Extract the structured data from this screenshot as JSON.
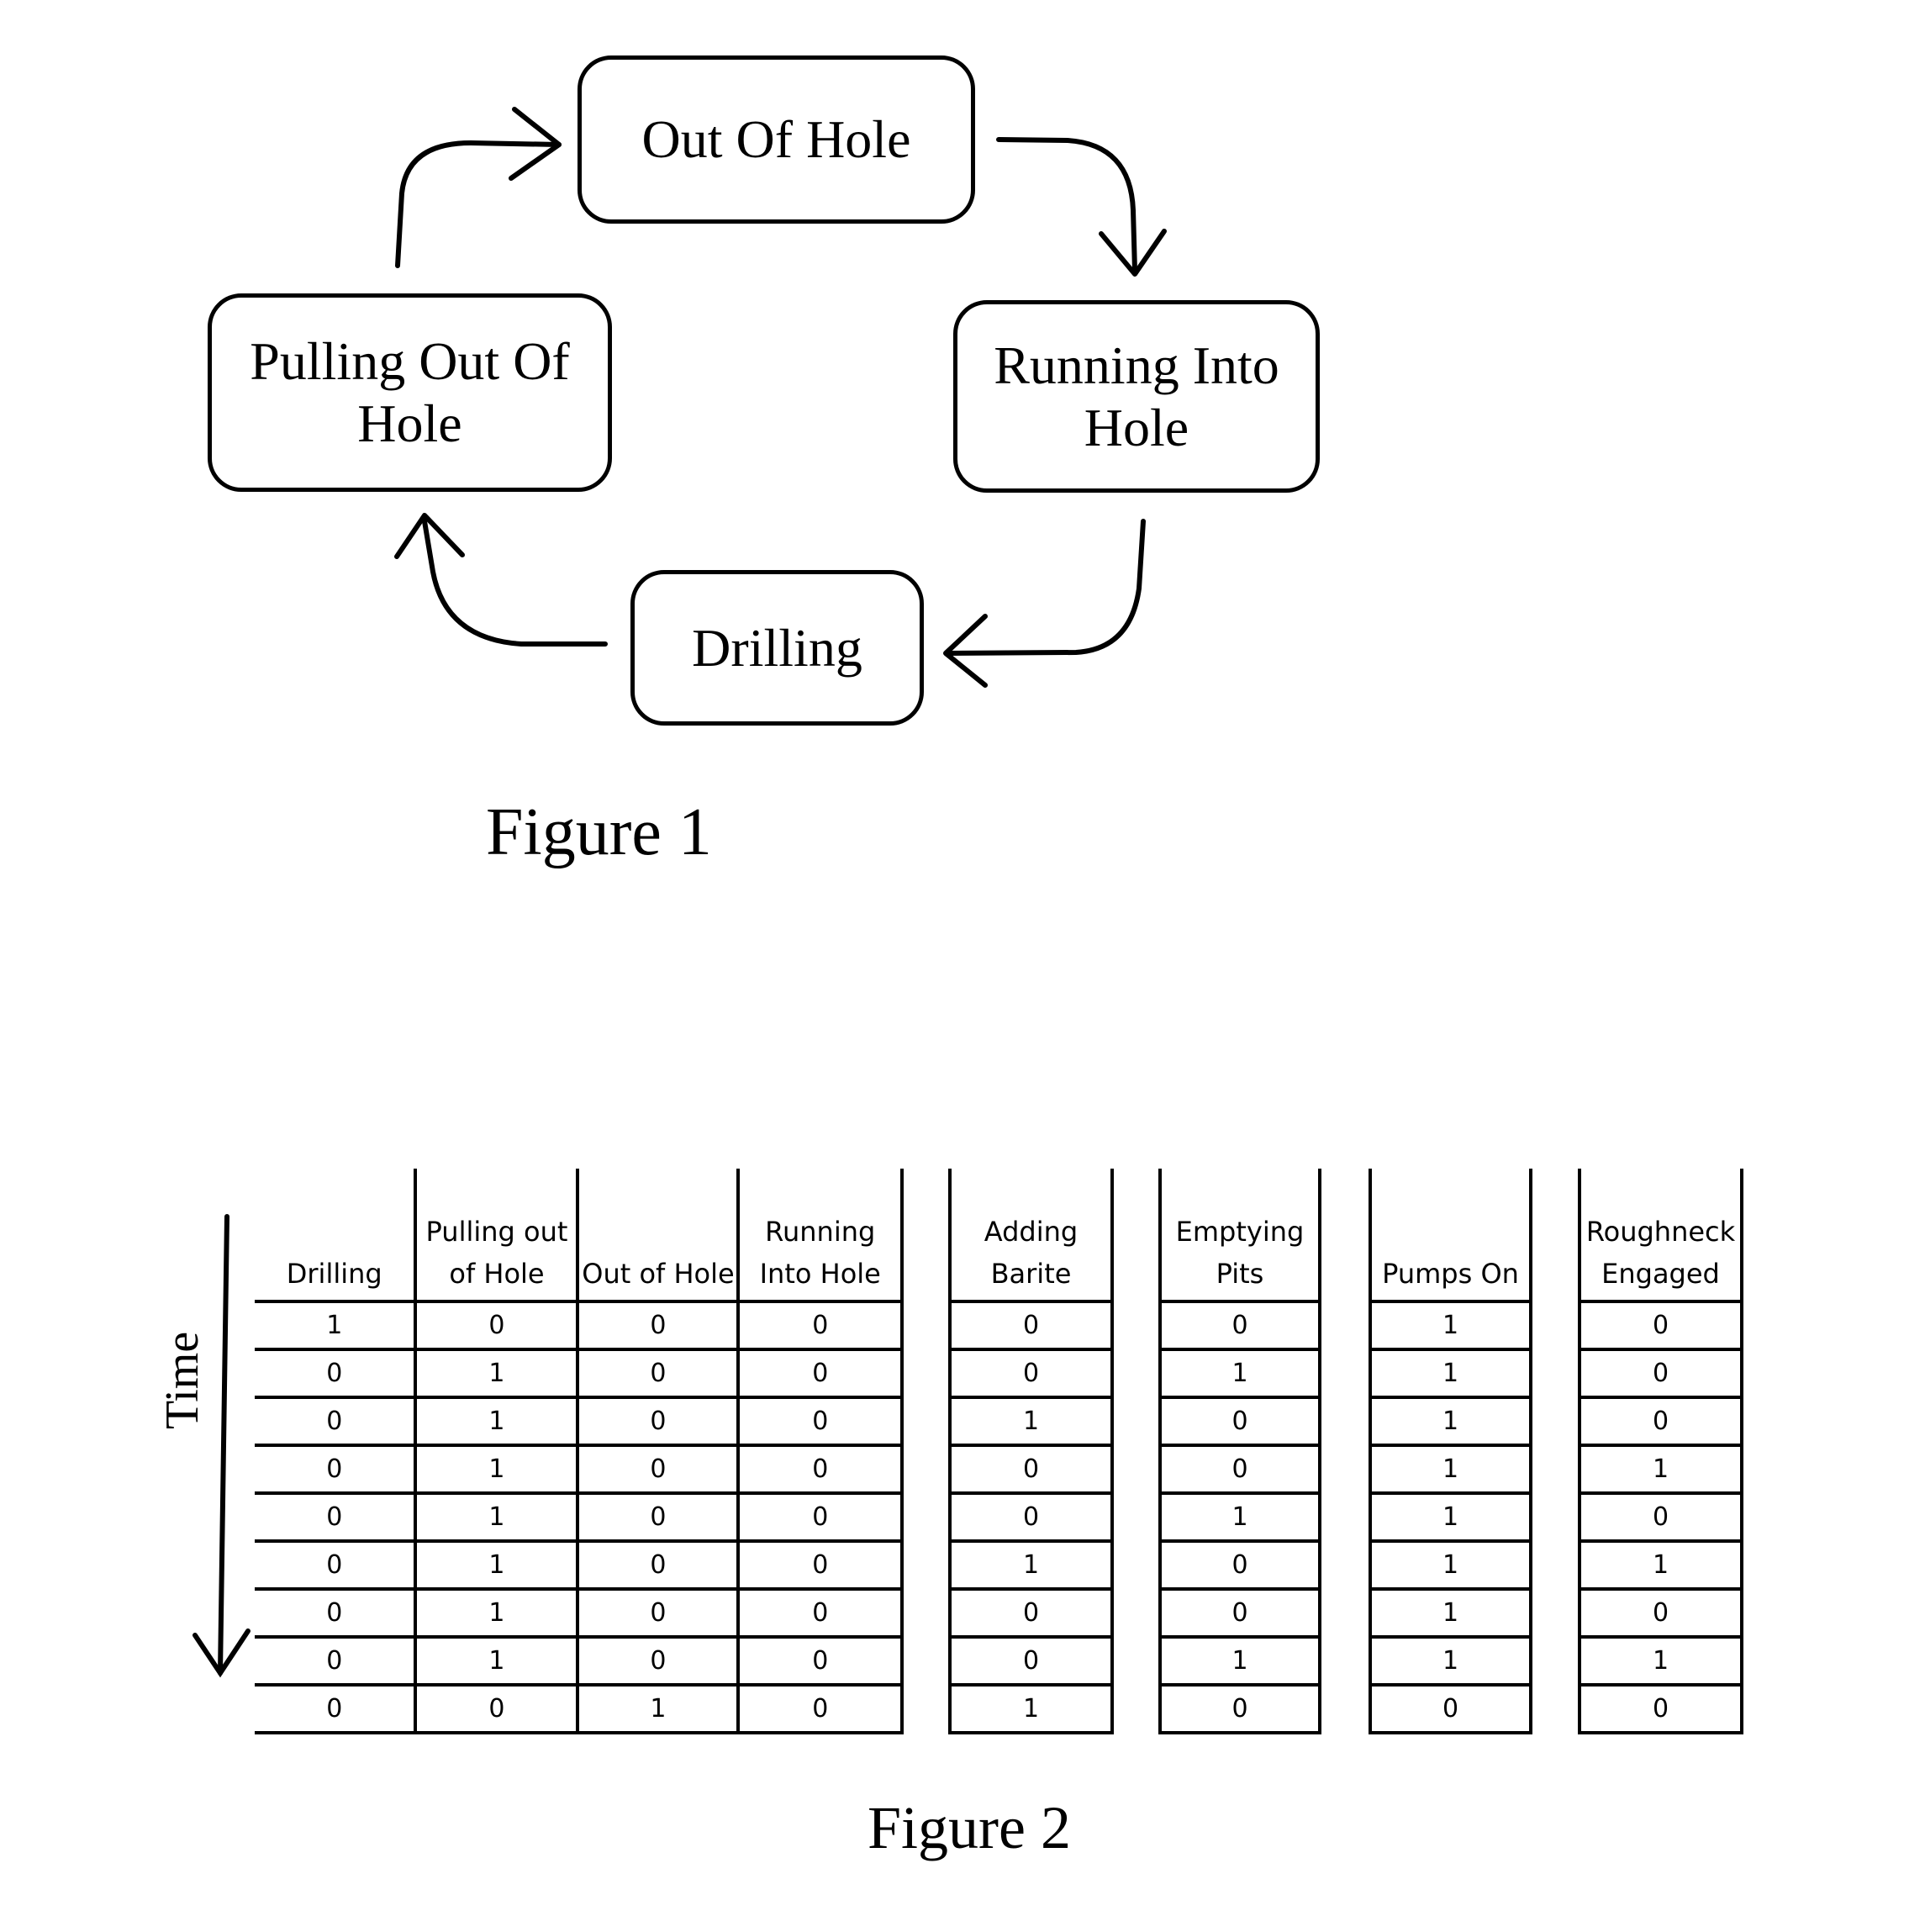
{
  "figure1": {
    "caption": "Figure 1",
    "states": [
      {
        "id": "out-of-hole",
        "label": "Out Of Hole"
      },
      {
        "id": "running-into-hole",
        "label": "Running Into Hole"
      },
      {
        "id": "drilling",
        "label": "Drilling"
      },
      {
        "id": "pulling-out-of-hole",
        "label": "Pulling Out Of Hole"
      }
    ],
    "transitions": [
      {
        "from": "out-of-hole",
        "to": "running-into-hole"
      },
      {
        "from": "running-into-hole",
        "to": "drilling"
      },
      {
        "from": "drilling",
        "to": "pulling-out-of-hole"
      },
      {
        "from": "pulling-out-of-hole",
        "to": "out-of-hole"
      }
    ]
  },
  "figure2": {
    "caption": "Figure 2",
    "axis_label": "Time",
    "state_table": {
      "headers": [
        "Drilling",
        "Pulling out of Hole",
        "Out of Hole",
        "Running Into Hole"
      ],
      "rows": [
        [
          "1",
          "0",
          "0",
          "0"
        ],
        [
          "0",
          "1",
          "0",
          "0"
        ],
        [
          "0",
          "1",
          "0",
          "0"
        ],
        [
          "0",
          "1",
          "0",
          "0"
        ],
        [
          "0",
          "1",
          "0",
          "0"
        ],
        [
          "0",
          "1",
          "0",
          "0"
        ],
        [
          "0",
          "1",
          "0",
          "0"
        ],
        [
          "0",
          "1",
          "0",
          "0"
        ],
        [
          "0",
          "0",
          "1",
          "0"
        ]
      ]
    },
    "feature_tables": [
      {
        "header": "Adding Barite",
        "values": [
          "0",
          "0",
          "1",
          "0",
          "0",
          "1",
          "0",
          "0",
          "1"
        ]
      },
      {
        "header": "Emptying Pits",
        "values": [
          "0",
          "1",
          "0",
          "0",
          "1",
          "0",
          "0",
          "1",
          "0"
        ]
      },
      {
        "header": "Pumps On",
        "values": [
          "1",
          "1",
          "1",
          "1",
          "1",
          "1",
          "1",
          "1",
          "0"
        ]
      },
      {
        "header": "Roughneck Engaged",
        "values": [
          "0",
          "0",
          "0",
          "1",
          "0",
          "1",
          "0",
          "1",
          "0"
        ]
      }
    ]
  }
}
